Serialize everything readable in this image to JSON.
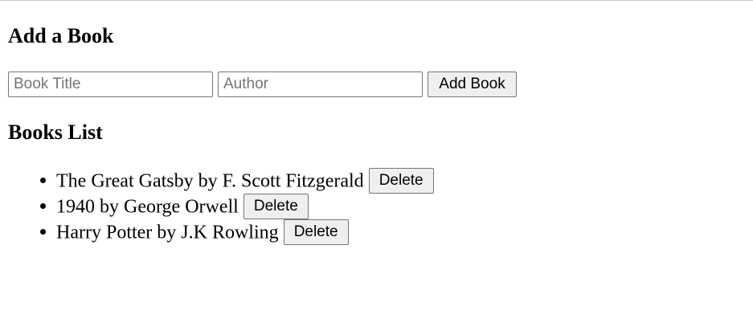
{
  "add_section": {
    "heading": "Add a Book",
    "title_placeholder": "Book Title",
    "author_placeholder": "Author",
    "title_value": "",
    "author_value": "",
    "submit_label": "Add Book"
  },
  "list_section": {
    "heading": "Books List",
    "delete_label": "Delete",
    "books": [
      {
        "text": "The Great Gatsby by F. Scott Fitzgerald"
      },
      {
        "text": "1940 by George Orwell"
      },
      {
        "text": "Harry Potter by J.K Rowling"
      }
    ]
  }
}
